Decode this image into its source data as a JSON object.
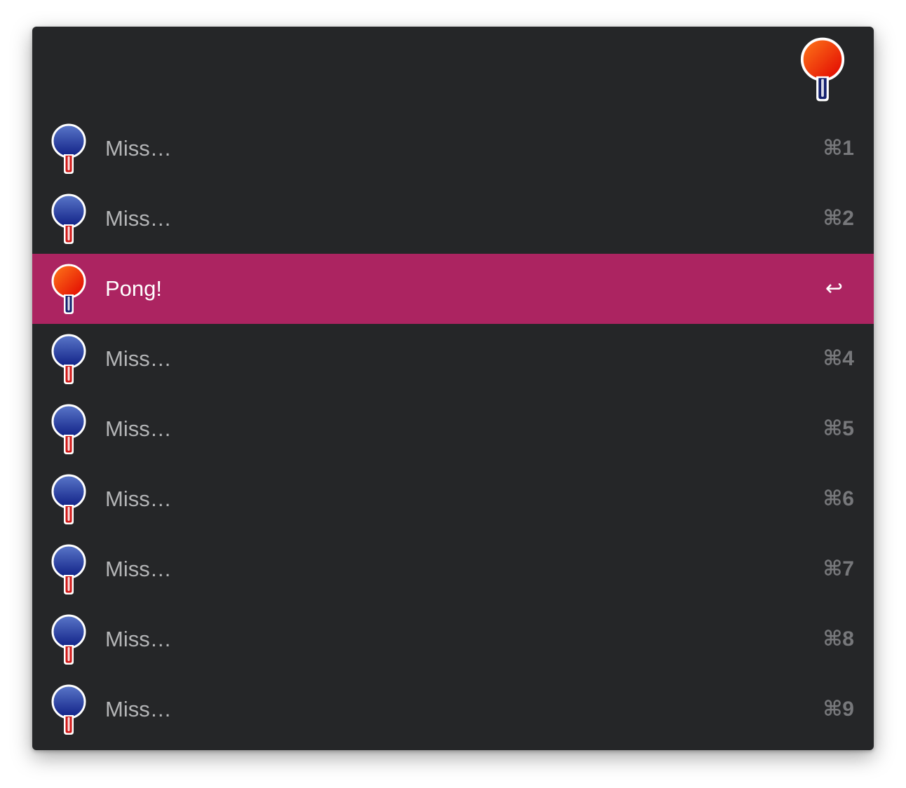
{
  "colors": {
    "window_bg": "#252628",
    "selected_bg": "#ac2461",
    "text": "#b4b5b7",
    "selected_text": "#ffffff",
    "shortcut": "#77787b"
  },
  "header": {
    "icon": "red-paddle-icon"
  },
  "rows": [
    {
      "title": "Miss…",
      "shortcut": "⌘1",
      "icon": "blue-paddle-icon",
      "selected": false
    },
    {
      "title": "Miss…",
      "shortcut": "⌘2",
      "icon": "blue-paddle-icon",
      "selected": false
    },
    {
      "title": "Pong!",
      "shortcut": "↩",
      "icon": "red-paddle-icon",
      "selected": true
    },
    {
      "title": "Miss…",
      "shortcut": "⌘4",
      "icon": "blue-paddle-icon",
      "selected": false
    },
    {
      "title": "Miss…",
      "shortcut": "⌘5",
      "icon": "blue-paddle-icon",
      "selected": false
    },
    {
      "title": "Miss…",
      "shortcut": "⌘6",
      "icon": "blue-paddle-icon",
      "selected": false
    },
    {
      "title": "Miss…",
      "shortcut": "⌘7",
      "icon": "blue-paddle-icon",
      "selected": false
    },
    {
      "title": "Miss…",
      "shortcut": "⌘8",
      "icon": "blue-paddle-icon",
      "selected": false
    },
    {
      "title": "Miss…",
      "shortcut": "⌘9",
      "icon": "blue-paddle-icon",
      "selected": false
    }
  ]
}
